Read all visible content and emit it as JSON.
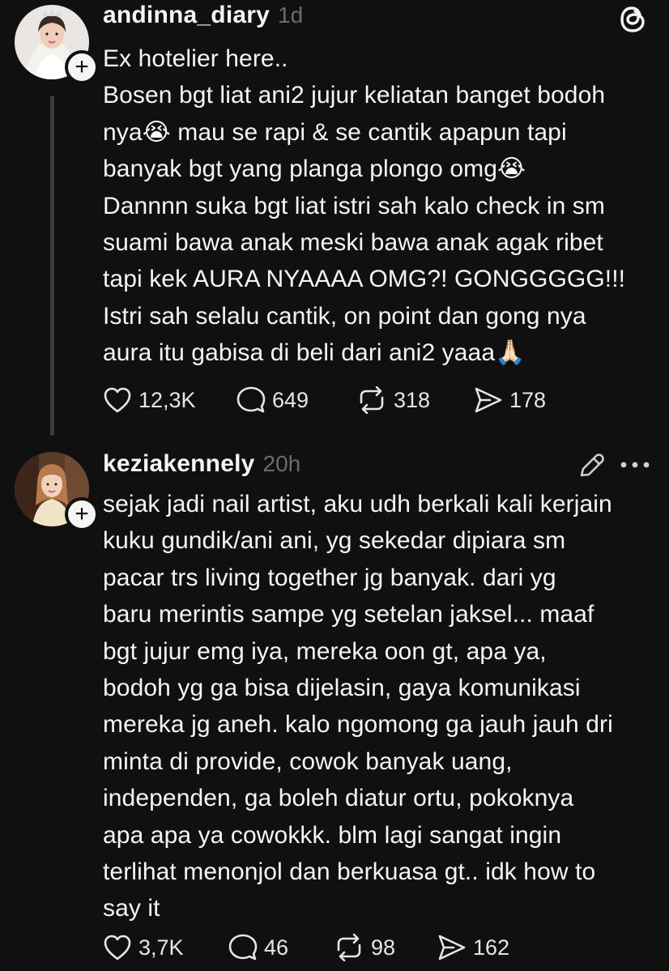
{
  "posts": [
    {
      "username": "andinna_diary",
      "timestamp": "1d",
      "body": "Ex hotelier here..\nBosen bgt liat ani2 jujur keliatan banget bodoh\nnya😭 mau se rapi & se cantik apapun tapi\nbanyak bgt yang planga plongo omg😭\nDannnn suka bgt liat istri sah kalo check in sm\nsuami bawa anak meski bawa anak agak ribet\ntapi kek AURA NYAAAA OMG?! GONGGGGG!!!\nIstri sah selalu cantik, on point dan gong nya\naura itu gabisa di beli dari ani2 yaaa🙏🏻",
      "stats": {
        "likes": "12,3K",
        "replies": "649",
        "reposts": "318",
        "shares": "178"
      }
    },
    {
      "username": "keziakennely",
      "timestamp": "20h",
      "body": "sejak jadi nail artist, aku udh berkali kali kerjain\nkuku gundik/ani ani, yg sekedar dipiara sm\npacar trs living together jg banyak. dari yg\nbaru merintis sampe yg setelan jaksel... maaf\nbgt jujur emg iya, mereka oon gt, apa ya,\nbodoh yg ga bisa dijelasin, gaya komunikasi\nmereka jg aneh. kalo ngomong ga jauh jauh dri\nminta di provide, cowok banyak uang,\nindependen, ga boleh diatur ortu, pokoknya\napa apa ya cowokkk. blm lagi sangat ingin\nterlihat menonjol dan berkuasa gt.. idk how to\nsay it",
      "stats": {
        "likes": "3,7K",
        "replies": "46",
        "reposts": "98",
        "shares": "162"
      }
    }
  ],
  "follow_badge_symbol": "+",
  "icons": {
    "app_logo": "threads-logo-icon",
    "edit": "pencil-icon",
    "more": "more-horizontal-icon",
    "like": "heart-icon",
    "reply": "comment-bubble-icon",
    "repost": "repost-icon",
    "share": "send-icon"
  },
  "colors": {
    "background": "#101010",
    "text": "#f3f5f7",
    "muted": "#6b6b6b",
    "thread_line": "#3a3a3a"
  }
}
